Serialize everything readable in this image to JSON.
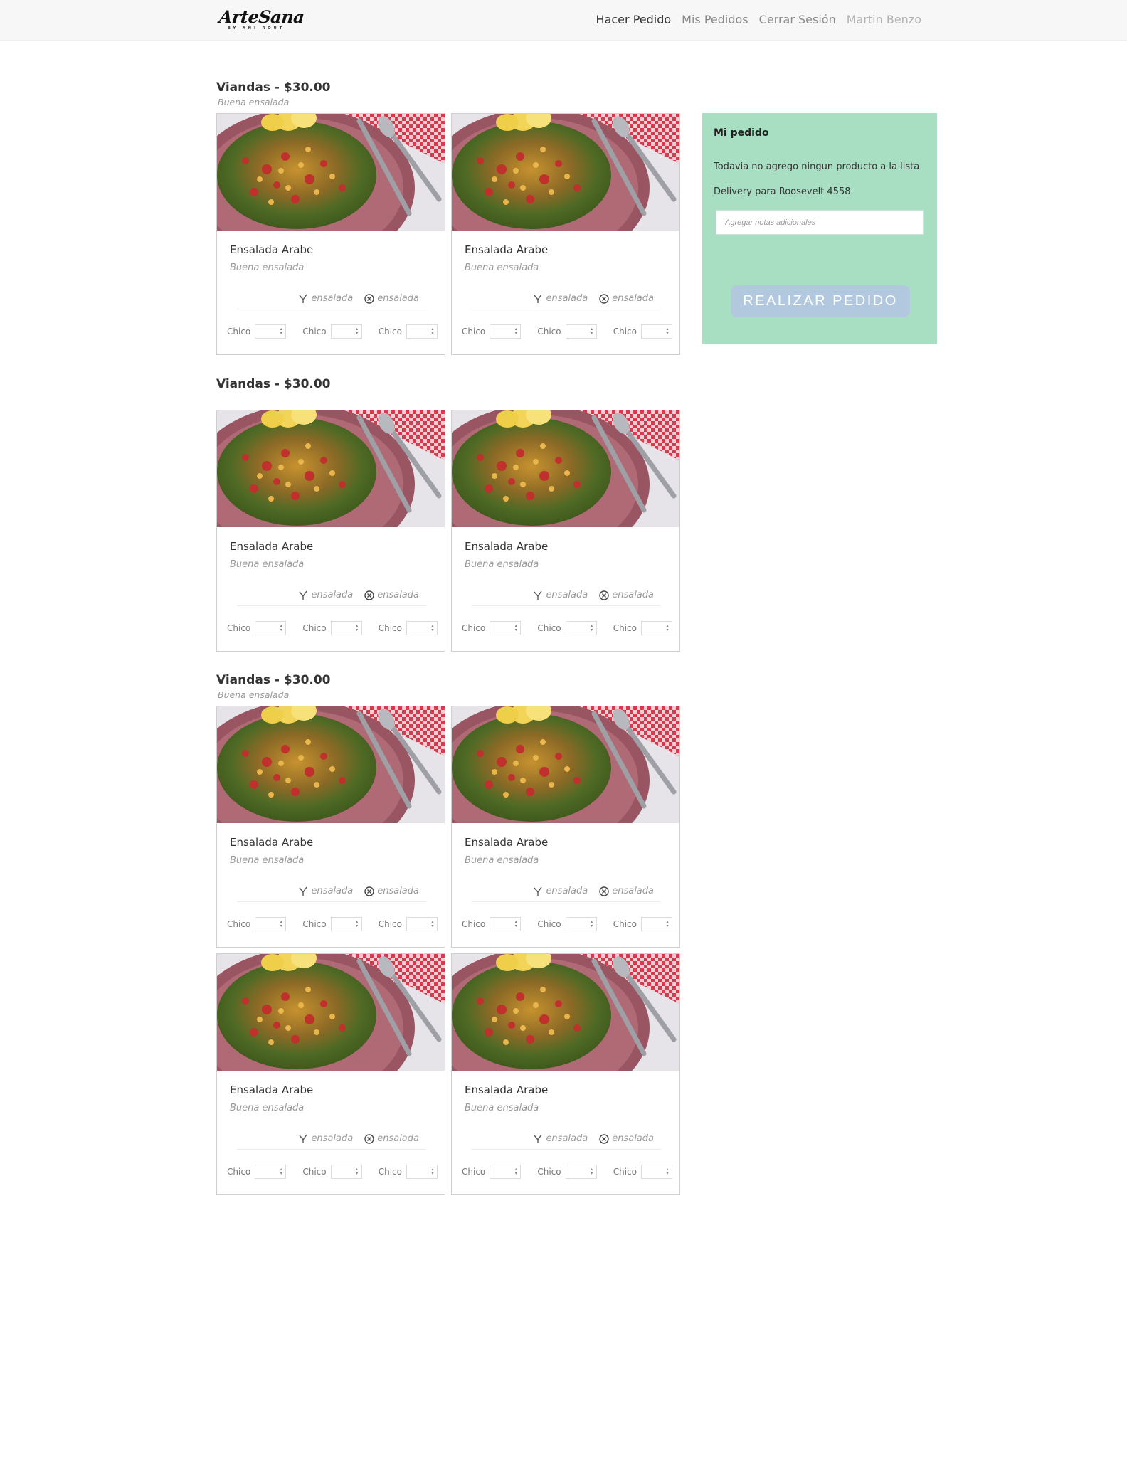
{
  "nav": {
    "brand": "ArteSana",
    "brand_sub": "BY ANI ROUT",
    "links": [
      "Hacer Pedido",
      "Mis Pedidos",
      "Cerrar Sesión"
    ],
    "user": "Martin Benzo"
  },
  "sections": [
    {
      "title": "Viandas - $30.00",
      "subtitle": "Buena ensalada",
      "products": [
        {
          "name": "Ensalada Arabe",
          "description": "Buena ensalada",
          "tags": [
            {
              "icon": "leaf-icon",
              "label": "ensalada"
            },
            {
              "icon": "cross-circle-icon",
              "label": "ensalada"
            }
          ],
          "sizes": [
            "Chico",
            "Chico",
            "Chico"
          ]
        },
        {
          "name": "Ensalada Arabe",
          "description": "Buena ensalada",
          "tags": [
            {
              "icon": "leaf-icon",
              "label": "ensalada"
            },
            {
              "icon": "cross-circle-icon",
              "label": "ensalada"
            }
          ],
          "sizes": [
            "Chico",
            "Chico",
            "Chico"
          ]
        }
      ]
    },
    {
      "title": "Viandas - $30.00",
      "subtitle": "",
      "products": [
        {
          "name": "Ensalada Arabe",
          "description": "Buena ensalada",
          "tags": [
            {
              "icon": "leaf-icon",
              "label": "ensalada"
            },
            {
              "icon": "cross-circle-icon",
              "label": "ensalada"
            }
          ],
          "sizes": [
            "Chico",
            "Chico",
            "Chico"
          ]
        },
        {
          "name": "Ensalada Arabe",
          "description": "Buena ensalada",
          "tags": [
            {
              "icon": "leaf-icon",
              "label": "ensalada"
            },
            {
              "icon": "cross-circle-icon",
              "label": "ensalada"
            }
          ],
          "sizes": [
            "Chico",
            "Chico",
            "Chico"
          ]
        }
      ]
    },
    {
      "title": "Viandas - $30.00",
      "subtitle": "Buena ensalada",
      "products": [
        {
          "name": "Ensalada Arabe",
          "description": "Buena ensalada",
          "tags": [
            {
              "icon": "leaf-icon",
              "label": "ensalada"
            },
            {
              "icon": "cross-circle-icon",
              "label": "ensalada"
            }
          ],
          "sizes": [
            "Chico",
            "Chico",
            "Chico"
          ]
        },
        {
          "name": "Ensalada Arabe",
          "description": "Buena ensalada",
          "tags": [
            {
              "icon": "leaf-icon",
              "label": "ensalada"
            },
            {
              "icon": "cross-circle-icon",
              "label": "ensalada"
            }
          ],
          "sizes": [
            "Chico",
            "Chico",
            "Chico"
          ]
        },
        {
          "name": "Ensalada Arabe",
          "description": "Buena ensalada",
          "tags": [
            {
              "icon": "leaf-icon",
              "label": "ensalada"
            },
            {
              "icon": "cross-circle-icon",
              "label": "ensalada"
            }
          ],
          "sizes": [
            "Chico",
            "Chico",
            "Chico"
          ]
        },
        {
          "name": "Ensalada Arabe",
          "description": "Buena ensalada",
          "tags": [
            {
              "icon": "leaf-icon",
              "label": "ensalada"
            },
            {
              "icon": "cross-circle-icon",
              "label": "ensalada"
            }
          ],
          "sizes": [
            "Chico",
            "Chico",
            "Chico"
          ]
        }
      ]
    }
  ],
  "order": {
    "title": "Mi pedido",
    "empty_message": "Todavia no agrego ningun producto a la lista",
    "delivery": "Delivery para Roosevelt 4558",
    "notes_placeholder": "Agregar notas adicionales",
    "button_label": "REALIZAR PEDIDO"
  },
  "colors": {
    "order_panel": "#a8dfc2",
    "order_button": "#b2c8df",
    "navbar": "#f7f7f7"
  }
}
